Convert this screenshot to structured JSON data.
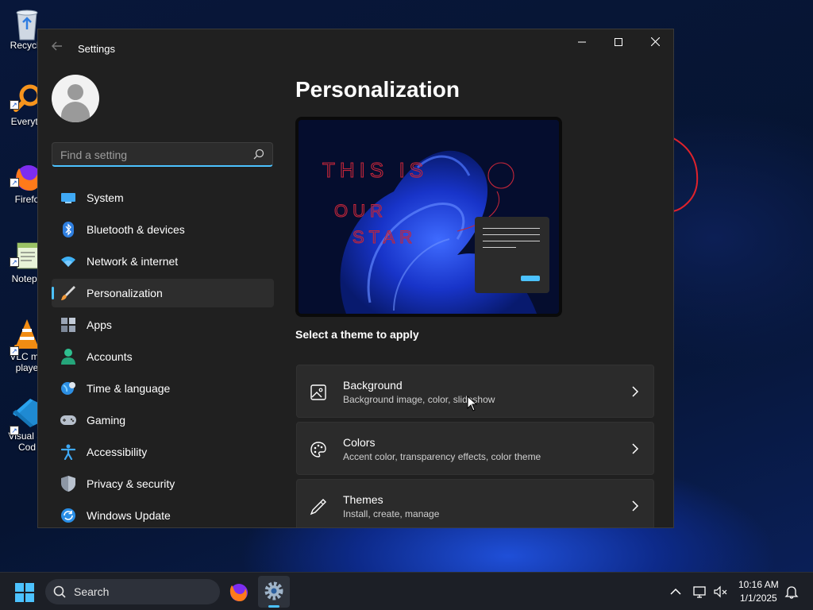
{
  "desktop": {
    "icons": [
      {
        "label": "Recycle",
        "icon": "recycle-bin-icon"
      },
      {
        "label": "Everyth",
        "icon": "everything-search-icon"
      },
      {
        "label": "Firefo",
        "icon": "firefox-icon"
      },
      {
        "label": "Notepa",
        "icon": "notepad-icon"
      },
      {
        "label": "VLC me\nplaye",
        "icon": "vlc-icon"
      },
      {
        "label": "Visual St\nCod",
        "icon": "vscode-icon"
      }
    ]
  },
  "window": {
    "title": "Settings",
    "controls": {
      "minimize": "—",
      "maximize": "☐",
      "close": "✕"
    }
  },
  "search": {
    "placeholder": "Find a setting",
    "value": ""
  },
  "nav": {
    "items": [
      {
        "label": "System",
        "icon": "system-icon"
      },
      {
        "label": "Bluetooth & devices",
        "icon": "bluetooth-icon"
      },
      {
        "label": "Network & internet",
        "icon": "wifi-icon"
      },
      {
        "label": "Personalization",
        "icon": "brush-icon",
        "active": true
      },
      {
        "label": "Apps",
        "icon": "apps-icon"
      },
      {
        "label": "Accounts",
        "icon": "accounts-icon"
      },
      {
        "label": "Time & language",
        "icon": "globe-clock-icon"
      },
      {
        "label": "Gaming",
        "icon": "gamepad-icon"
      },
      {
        "label": "Accessibility",
        "icon": "accessibility-icon"
      },
      {
        "label": "Privacy & security",
        "icon": "shield-icon"
      },
      {
        "label": "Windows Update",
        "icon": "update-icon"
      }
    ]
  },
  "main": {
    "title": "Personalization",
    "preview_scribble": "THIS IS OUR STAR",
    "theme_heading": "Select a theme to apply",
    "cards": [
      {
        "title": "Background",
        "subtitle": "Background image, color, slideshow",
        "icon": "image-icon"
      },
      {
        "title": "Colors",
        "subtitle": "Accent color, transparency effects, color theme",
        "icon": "palette-icon"
      },
      {
        "title": "Themes",
        "subtitle": "Install, create, manage",
        "icon": "pen-icon"
      }
    ]
  },
  "taskbar": {
    "search_label": "Search",
    "clock": {
      "time": "10:16 AM",
      "date": "1/1/2025"
    }
  },
  "colors": {
    "accent": "#4cc2ff",
    "window_bg": "#202020",
    "card_bg": "#2b2b2b"
  }
}
